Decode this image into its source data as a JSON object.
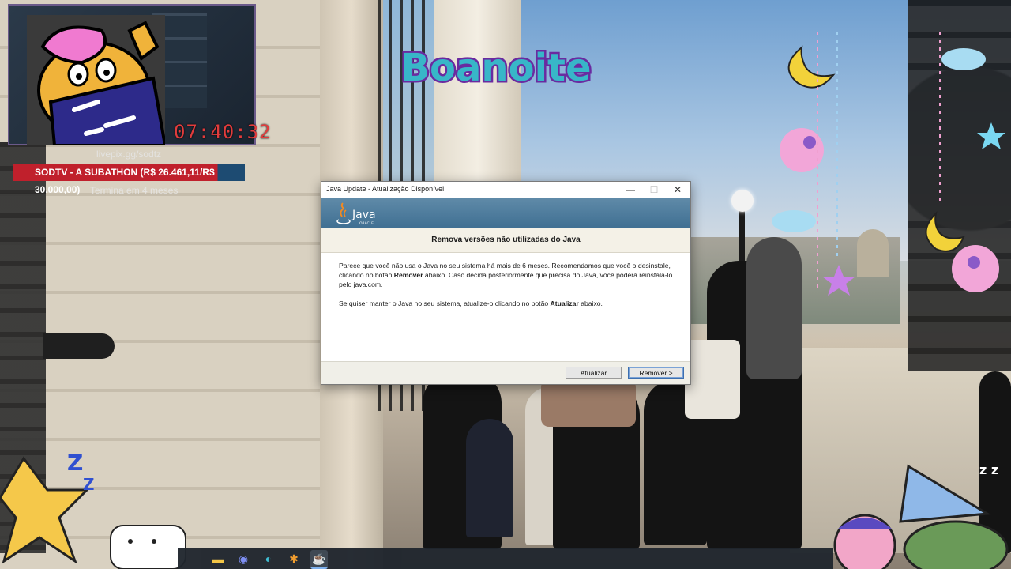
{
  "overlay": {
    "timer": "07:40:32",
    "livepix": "livepix.gg/sodtz",
    "subathon": "SODTV - A SUBATHON (R$ 26.461,11/R$ 30.000,00)",
    "subathon_progress": 0.882,
    "termina": "Termina em 4 meses",
    "greeting": "Boanoite"
  },
  "dialog": {
    "window_title": "Java Update - Atualização Disponível",
    "min_glyph": "—",
    "max_glyph": "☐",
    "close_glyph": "✕",
    "logo_text": "Java",
    "logo_sub": "ORACLE",
    "heading": "Remova versões não utilizadas do Java",
    "para1_a": "Parece que você não usa o Java no seu sistema há mais de 6 meses. Recomendamos que você o desinstale, clicando no botão ",
    "para1_bold": "Remover",
    "para1_b": " abaixo. Caso decida posteriormente que precisa do Java, você poderá reinstalá-lo pelo java.com.",
    "para2_a": "Se quiser manter o Java no seu sistema, atualize-o clicando no botão ",
    "para2_bold": "Atualizar",
    "para2_b": " abaixo.",
    "update_button": "Atualizar",
    "remove_button": "Remover >"
  },
  "taskbar": {
    "icons": [
      "file-explorer-icon",
      "discord-icon",
      "edge-icon",
      "app-icon",
      "java-icon"
    ]
  },
  "colors": {
    "banner": "#4f7c9d",
    "subathon_red": "#c0202c",
    "timer_red": "#e23c3c"
  }
}
